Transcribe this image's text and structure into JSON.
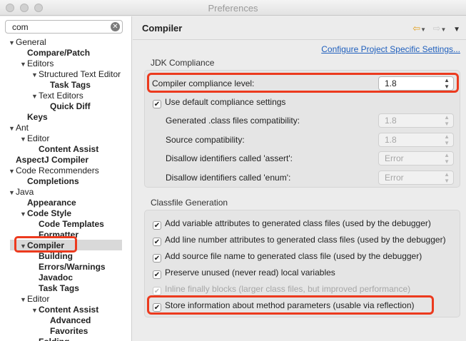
{
  "window": {
    "title": "Preferences"
  },
  "search": {
    "value": "com"
  },
  "tree": [
    {
      "label": "General",
      "level": 0,
      "toggle": "open",
      "bold": false
    },
    {
      "label": "Compare/Patch",
      "level": 1,
      "toggle": "",
      "bold": true
    },
    {
      "label": "Editors",
      "level": 1,
      "toggle": "open",
      "bold": false
    },
    {
      "label": "Structured Text Editor",
      "level": 2,
      "toggle": "open",
      "bold": false
    },
    {
      "label": "Task Tags",
      "level": 3,
      "toggle": "",
      "bold": true
    },
    {
      "label": "Text Editors",
      "level": 2,
      "toggle": "open",
      "bold": false
    },
    {
      "label": "Quick Diff",
      "level": 3,
      "toggle": "",
      "bold": true
    },
    {
      "label": "Keys",
      "level": 1,
      "toggle": "",
      "bold": true
    },
    {
      "label": "Ant",
      "level": 0,
      "toggle": "open",
      "bold": false
    },
    {
      "label": "Editor",
      "level": 1,
      "toggle": "open",
      "bold": false
    },
    {
      "label": "Content Assist",
      "level": 2,
      "toggle": "",
      "bold": true
    },
    {
      "label": "AspectJ Compiler",
      "level": 0,
      "toggle": "",
      "bold": true
    },
    {
      "label": "Code Recommenders",
      "level": 0,
      "toggle": "open",
      "bold": false
    },
    {
      "label": "Completions",
      "level": 1,
      "toggle": "",
      "bold": true
    },
    {
      "label": "Java",
      "level": 0,
      "toggle": "open",
      "bold": false
    },
    {
      "label": "Appearance",
      "level": 1,
      "toggle": "",
      "bold": true
    },
    {
      "label": "Code Style",
      "level": 1,
      "toggle": "open",
      "bold": true
    },
    {
      "label": "Code Templates",
      "level": 2,
      "toggle": "",
      "bold": true
    },
    {
      "label": "Formatter",
      "level": 2,
      "toggle": "",
      "bold": true
    },
    {
      "label": "Compiler",
      "level": 1,
      "toggle": "open",
      "bold": true
    },
    {
      "label": "Building",
      "level": 2,
      "toggle": "",
      "bold": true
    },
    {
      "label": "Errors/Warnings",
      "level": 2,
      "toggle": "",
      "bold": true
    },
    {
      "label": "Javadoc",
      "level": 2,
      "toggle": "",
      "bold": true
    },
    {
      "label": "Task Tags",
      "level": 2,
      "toggle": "",
      "bold": true
    },
    {
      "label": "Editor",
      "level": 1,
      "toggle": "open",
      "bold": false
    },
    {
      "label": "Content Assist",
      "level": 2,
      "toggle": "open",
      "bold": true
    },
    {
      "label": "Advanced",
      "level": 3,
      "toggle": "",
      "bold": true
    },
    {
      "label": "Favorites",
      "level": 3,
      "toggle": "",
      "bold": true
    },
    {
      "label": "Folding",
      "level": 2,
      "toggle": "",
      "bold": true
    }
  ],
  "page": {
    "title": "Compiler",
    "configure_link": "Configure Project Specific Settings..."
  },
  "jdk": {
    "section_title": "JDK Compliance",
    "compliance_label": "Compiler compliance level:",
    "compliance_value": "1.8",
    "use_default_label": "Use default compliance settings",
    "generated_label": "Generated .class files compatibility:",
    "generated_value": "1.8",
    "source_label": "Source compatibility:",
    "source_value": "1.8",
    "assert_label": "Disallow identifiers called 'assert':",
    "assert_value": "Error",
    "enum_label": "Disallow identifiers called 'enum':",
    "enum_value": "Error"
  },
  "classfile": {
    "section_title": "Classfile Generation",
    "options": [
      {
        "label": "Add variable attributes to generated class files (used by the debugger)",
        "checked": true,
        "enabled": true
      },
      {
        "label": "Add line number attributes to generated class files (used by the debugger)",
        "checked": true,
        "enabled": true
      },
      {
        "label": "Add source file name to generated class file (used by the debugger)",
        "checked": true,
        "enabled": true
      },
      {
        "label": "Preserve unused (never read) local variables",
        "checked": true,
        "enabled": true
      },
      {
        "label": "Inline finally blocks (larger class files, but improved performance)",
        "checked": true,
        "enabled": false
      },
      {
        "label": "Store information about method parameters (usable via reflection)",
        "checked": true,
        "enabled": true
      }
    ]
  },
  "colors": {
    "highlight": "#ec3a1e",
    "link": "#1f5fbd",
    "selection": "#d9d9d9"
  }
}
